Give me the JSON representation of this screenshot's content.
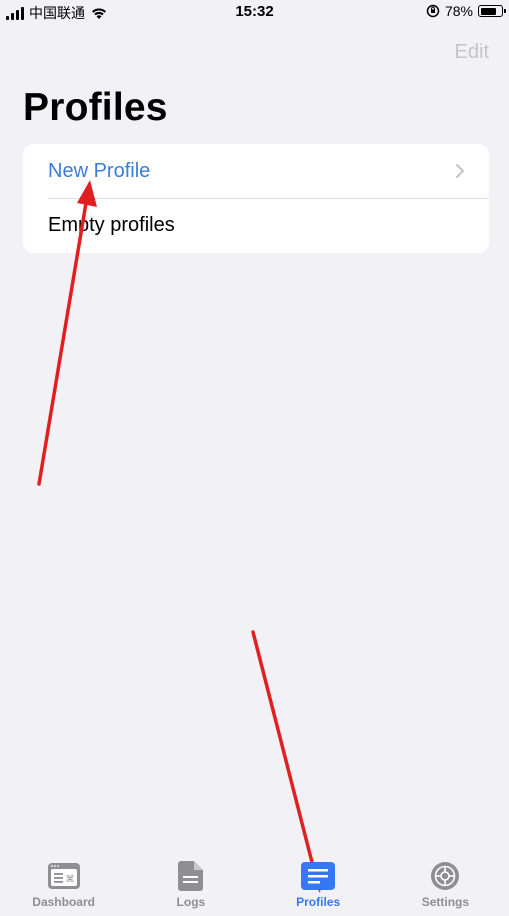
{
  "status_bar": {
    "carrier": "中国联通",
    "time": "15:32",
    "battery": "78%",
    "battery_level": 0.78
  },
  "nav": {
    "edit_label": "Edit",
    "title": "Profiles"
  },
  "list": {
    "items": [
      {
        "label": "New Profile"
      },
      {
        "label": "Empty profiles"
      }
    ]
  },
  "tab_bar": {
    "tabs": [
      {
        "label": "Dashboard",
        "icon": "dashboard-icon"
      },
      {
        "label": "Logs",
        "icon": "document-icon"
      },
      {
        "label": "Profiles",
        "icon": "list-icon",
        "active": true
      },
      {
        "label": "Settings",
        "icon": "gear-icon"
      }
    ]
  },
  "colors": {
    "accent": "#3478f6",
    "link": "#3a7dd8",
    "background": "#f2f1f6",
    "annotation_arrow": "#e02020",
    "inactive_tab": "#8e8e93"
  }
}
